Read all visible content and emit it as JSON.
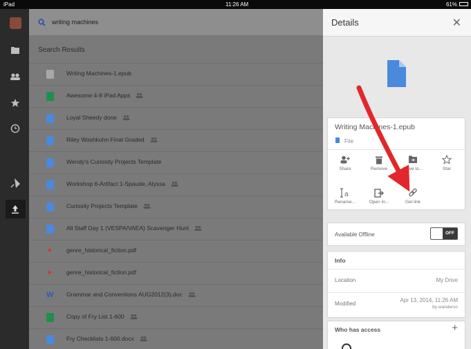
{
  "status_bar": {
    "device": "iPad",
    "time": "11:26 AM",
    "battery": "61%"
  },
  "search": {
    "value": "writing machines",
    "icon": "search-icon"
  },
  "results": {
    "title": "Search Results",
    "items": [
      {
        "name": "Writing Machines-1.epub",
        "type": "file",
        "shared": false
      },
      {
        "name": "Awesome 4-8 iPad Apps",
        "type": "sheet",
        "shared": true
      },
      {
        "name": "Loyal Sheedy done",
        "type": "doc",
        "shared": true
      },
      {
        "name": "Riley Washkuhn Final Graded",
        "type": "doc",
        "shared": true
      },
      {
        "name": "Wendy's Curiosity Projects Template",
        "type": "doc",
        "shared": false
      },
      {
        "name": "Workshop 6-Artifact 1-Spaude, Alyssa",
        "type": "doc",
        "shared": true
      },
      {
        "name": "Curiosity Projects Template",
        "type": "doc",
        "shared": true
      },
      {
        "name": "All Staff Day 1 (VESPA/VAEA) Scavenger Hunt",
        "type": "doc",
        "shared": true
      },
      {
        "name": "genre_historical_fiction.pdf",
        "type": "pdf",
        "shared": false
      },
      {
        "name": "genre_historical_fiction.pdf",
        "type": "pdf",
        "shared": false
      },
      {
        "name": "Grammar and Conventions AUG2012(3).doc",
        "type": "word",
        "shared": true
      },
      {
        "name": "Copy of Fry List 1-600",
        "type": "sheet",
        "shared": true
      },
      {
        "name": "Fry Checklists 1-600.docx",
        "type": "doc",
        "shared": true
      }
    ]
  },
  "details": {
    "title": "Details",
    "file_name": "Writing Machines-1.epub",
    "file_type": "File",
    "actions": [
      {
        "label": "Share",
        "icon": "add-person-icon"
      },
      {
        "label": "Remove",
        "icon": "trash-icon"
      },
      {
        "label": "Move to...",
        "icon": "move-folder-icon"
      },
      {
        "label": "Star",
        "icon": "star-icon"
      },
      {
        "label": "Rename...",
        "icon": "rename-icon"
      },
      {
        "label": "Open In...",
        "icon": "open-in-icon"
      },
      {
        "label": "Get link",
        "icon": "link-icon"
      }
    ],
    "offline_label": "Available Offline",
    "offline_toggle": "OFF",
    "info_header": "Info",
    "location_label": "Location",
    "location_value": "My Drive",
    "modified_label": "Modified",
    "modified_value": "Apr 13, 2014, 11:26 AM",
    "modified_by": "by wanderso",
    "access_header": "Who has access"
  },
  "colors": {
    "accent": "#4a89dc",
    "arrow": "#e2262b",
    "sheet": "#1e8f4e",
    "pdf": "#d9332b"
  }
}
